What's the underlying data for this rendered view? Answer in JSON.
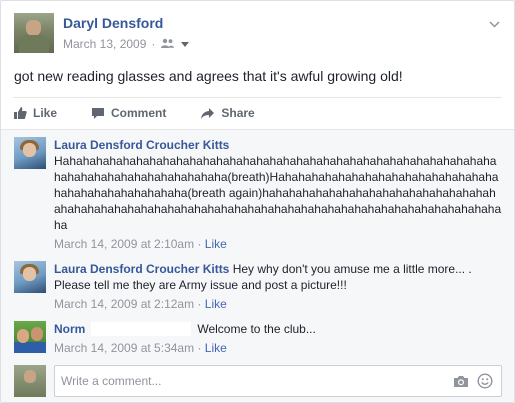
{
  "post": {
    "author": "Daryl Densford",
    "date": "March 13, 2009",
    "separator": "·",
    "privacy_icon": "friends-icon",
    "text": "got new reading glasses and agrees that it's awful growing old!",
    "actions": {
      "like": "Like",
      "comment": "Comment",
      "share": "Share"
    }
  },
  "comments": [
    {
      "author": "Laura Densford Croucher Kitts",
      "text": "Hahahahahahahahahahahahahahahahahahahahahahahahahahahahahahahahahahahahahahahahahahahahahaha(breath)Hahahahahahahahahahahahahahahahahahahahahahahahahahaha(breath again)hahahahahahahahahahahahahahahahahahahahahahahahahahahahahahahahahahahahahahahahahahahahahahahahahahahaha",
      "timestamp": "March 14, 2009 at 2:10am",
      "like": "Like"
    },
    {
      "author": "Laura Densford Croucher Kitts",
      "text": "Hey why don't you amuse me a little more... . Please tell me they are Army issue and post a picture!!!",
      "timestamp": "March 14, 2009 at 2:12am",
      "like": "Like"
    },
    {
      "author": "Norm",
      "text": "Welcome to the club...",
      "timestamp": "March 14, 2009 at 5:34am",
      "like": "Like"
    }
  ],
  "composer": {
    "placeholder": "Write a comment..."
  },
  "colors": {
    "link": "#365899",
    "meta": "#90949c",
    "background": "#f6f7f9"
  }
}
